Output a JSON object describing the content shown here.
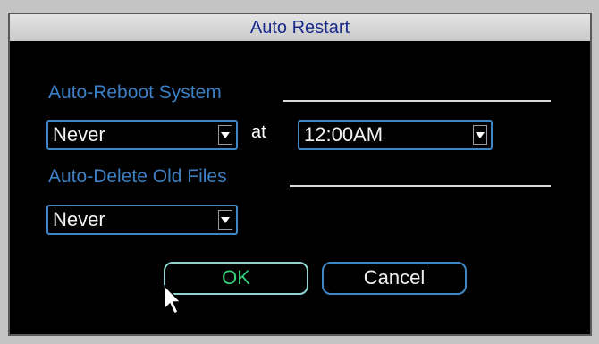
{
  "dialog": {
    "title": "Auto Restart"
  },
  "auto_reboot": {
    "section_label": "Auto-Reboot System",
    "frequency_value": "Never",
    "at_label": "at",
    "time_value": "12:00AM"
  },
  "auto_delete": {
    "section_label": "Auto-Delete Old Files",
    "frequency_value": "Never"
  },
  "buttons": {
    "ok_label": "OK",
    "cancel_label": "Cancel"
  },
  "colors": {
    "dialog_background": "#000000",
    "title_text": "#1a2a8a",
    "section_label": "#3c7fc4",
    "field_border": "#3f86c6",
    "ok_text": "#32d17a"
  },
  "icons": {
    "dropdown": "chevron-down-icon",
    "pointer": "mouse-cursor-icon"
  }
}
